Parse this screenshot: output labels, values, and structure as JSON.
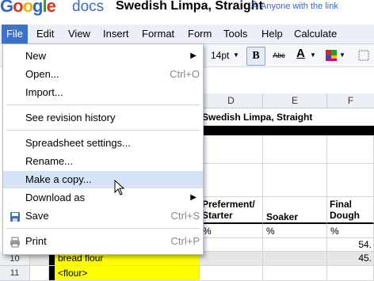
{
  "header": {
    "logo_letters": [
      {
        "ch": "G",
        "color": "#3366cc"
      },
      {
        "ch": "o",
        "color": "#dd3322"
      },
      {
        "ch": "o",
        "color": "#f0b400"
      },
      {
        "ch": "g",
        "color": "#3366cc"
      },
      {
        "ch": "l",
        "color": "#33a033"
      },
      {
        "ch": "e",
        "color": "#dd3322"
      }
    ],
    "docs_label": "docs",
    "doc_title": "Swedish Limpa, Straight",
    "share_label": "Anyone with the link",
    "share_icon": "people-icon"
  },
  "menubar": {
    "items": [
      "File",
      "Edit",
      "View",
      "Insert",
      "Format",
      "Form",
      "Tools",
      "Help",
      "Calculate"
    ],
    "active": "File"
  },
  "toolbar": {
    "font_size": "14pt",
    "bold": "B",
    "strike": "Abc",
    "text_color_letter": "A",
    "text_color": "#000000",
    "fill_color_icon": "fill-color-icon",
    "borders_icon": "borders-icon"
  },
  "file_menu": {
    "items": [
      {
        "label": "New",
        "shortcut": "",
        "submenu": true
      },
      {
        "label": "Open...",
        "shortcut": "Ctrl+O",
        "submenu": false
      },
      {
        "label": "Import...",
        "shortcut": "",
        "submenu": false
      },
      {
        "label": "See revision history",
        "shortcut": "",
        "submenu": false
      },
      {
        "label": "Spreadsheet settings...",
        "shortcut": "",
        "submenu": false
      },
      {
        "label": "Rename...",
        "shortcut": "",
        "submenu": false
      },
      {
        "label": "Make a copy...",
        "shortcut": "",
        "submenu": false,
        "highlighted": true
      },
      {
        "label": "Download as",
        "shortcut": "",
        "submenu": true
      },
      {
        "label": "Save",
        "shortcut": "Ctrl+S",
        "submenu": false,
        "icon": "save-icon"
      },
      {
        "label": "Print",
        "shortcut": "Ctrl+P",
        "submenu": false,
        "icon": "print-icon"
      }
    ],
    "submenu_arrow": "▶"
  },
  "sheet": {
    "columns": [
      "D",
      "E",
      "F"
    ],
    "title_cell": "Swedish Limpa, Straight",
    "headers": {
      "d": "Preferment/ Starter",
      "e": "Soaker",
      "f": "Final Dough"
    },
    "units": {
      "d": "%",
      "e": "%",
      "f": "%"
    },
    "f_values": [
      "54.",
      "45."
    ],
    "rows": [
      {
        "num": "10",
        "label": "bread flour"
      },
      {
        "num": "11",
        "label": "<flour>"
      }
    ],
    "highlight_color": "#ffff00"
  }
}
